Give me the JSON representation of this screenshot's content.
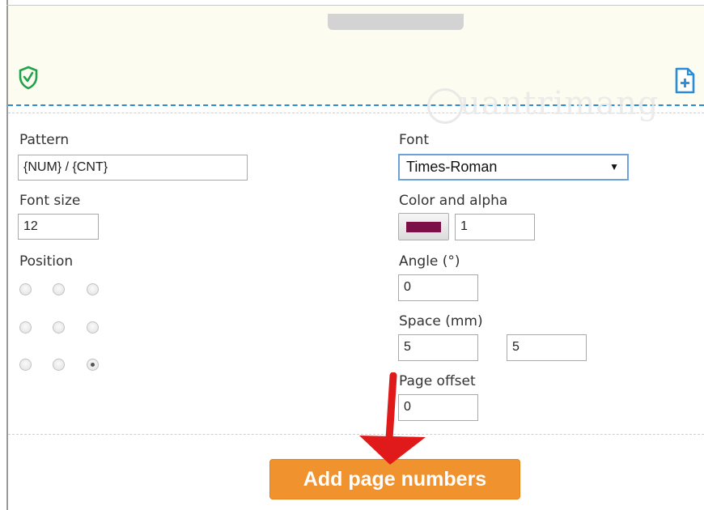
{
  "watermark": {
    "text": "uantrimang"
  },
  "form": {
    "pattern": {
      "label": "Pattern",
      "value": "{NUM} / {CNT}"
    },
    "font_size": {
      "label": "Font size",
      "value": "12"
    },
    "position": {
      "label": "Position",
      "options": [
        "top-left",
        "top-center",
        "top-right",
        "middle-left",
        "middle-center",
        "middle-right",
        "bottom-left",
        "bottom-center",
        "bottom-right"
      ],
      "selected": "bottom-right"
    },
    "font": {
      "label": "Font",
      "value": "Times-Roman",
      "arrow": "▼"
    },
    "color": {
      "label": "Color and alpha",
      "swatch_color": "#7a1047",
      "alpha": "1"
    },
    "angle": {
      "label": "Angle (°)",
      "value": "0"
    },
    "space": {
      "label": "Space (mm)",
      "x": "5",
      "y": "5"
    },
    "page_offset": {
      "label": "Page offset",
      "value": "0"
    }
  },
  "submit": {
    "label": "Add page numbers",
    "color": "#f0922d"
  },
  "colors": {
    "accent_blue": "#2a8bd6",
    "shield_green": "#1ea34a",
    "annotation_arrow": "#e01a1a"
  }
}
